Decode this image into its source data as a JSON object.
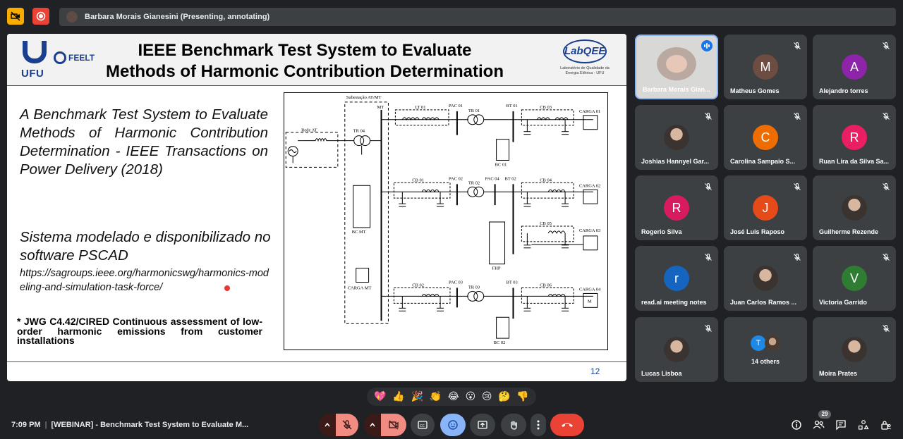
{
  "presenting": {
    "label": "Barbara Morais Gianesini (Presenting, annotating)"
  },
  "slide": {
    "title_line1": "IEEE Benchmark Test System to Evaluate",
    "title_line2": "Methods of Harmonic Contribution Determination",
    "logo_ufu": "UFU",
    "logo_feelt": "FEELT",
    "logo_labqee": "LabQEE",
    "labqee_sub": "Laboratório de Qualidade da Energia Elétrica - UFU",
    "reference": "A Benchmark Test System to Evaluate Methods of Harmonic Contribution Determination - IEEE Transactions on Power Delivery (2018)",
    "pscad": "Sistema modelado e disponibilizado no software PSCAD",
    "url": "https://sagroups.ieee.org/harmonicswg/harmonics-modeling-and-simulation-task-force/",
    "jwg": "* JWG C4.42/CIRED Continuous assessment of low-order harmonic emissions from customer installations",
    "page_number": "12",
    "diagram_labels": {
      "substation": "Subestação AT/MT",
      "mt": "MT",
      "rede_at": "Rede AT",
      "tr04": "TR 04",
      "lt01": "LT 01",
      "pac01": "PAC 01",
      "tr01": "TR 01",
      "bt01": "BT 01",
      "cb03": "CB 03",
      "carga01": "CARGA 01",
      "bc01": "BC 01",
      "bcmt": "BC MT",
      "cb01": "CB 01",
      "pac02": "PAC 02",
      "tr02": "TR 02",
      "pac04": "PAC 04",
      "bt02": "BT 02",
      "cb04": "CB 04",
      "carga02": "CARGA 02",
      "cb05": "CB 05",
      "carga03": "CARGA 03",
      "fhp": "FHP",
      "cargamt": "CARGA MT",
      "cb02": "CB 02",
      "pac03": "PAC 03",
      "tr03": "TR 03",
      "bt03": "BT 03",
      "cb06": "CB 06",
      "carga04": "CARGA 04",
      "bc02": "BC 02",
      "m": "M"
    }
  },
  "participants": [
    {
      "name": "Barbara Morais Gian...",
      "type": "video",
      "speaking": true
    },
    {
      "name": "Matheus Gomes",
      "initial": "M",
      "color": "#6d4c41"
    },
    {
      "name": "Alejandro torres",
      "initial": "A",
      "color": "#8e24aa"
    },
    {
      "name": "Joshias Hannyel Gar...",
      "type": "photo"
    },
    {
      "name": "Carolina Sampaio S...",
      "initial": "C",
      "color": "#ef6c00"
    },
    {
      "name": "Ruan Lira da Silva Sa...",
      "initial": "R",
      "color": "#e91e63"
    },
    {
      "name": "Rogerio Silva",
      "initial": "R",
      "color": "#d81b60"
    },
    {
      "name": "José Luis Raposo",
      "initial": "J",
      "color": "#e64a19"
    },
    {
      "name": "Guilherme Rezende",
      "type": "photo"
    },
    {
      "name": "read.ai meeting notes",
      "initial": "r",
      "color": "#1565c0"
    },
    {
      "name": "Juan Carlos Ramos ...",
      "type": "photo"
    },
    {
      "name": "Victoria Garrido",
      "initial": "V",
      "color": "#2e7d32"
    },
    {
      "name": "Lucas Lisboa",
      "type": "photo"
    },
    {
      "name": "14 others",
      "type": "others",
      "initial": "T"
    },
    {
      "name": "Moira Prates",
      "type": "photo"
    }
  ],
  "reactions": [
    "💖",
    "👍",
    "🎉",
    "👏",
    "😂",
    "😮",
    "😢",
    "🤔",
    "👎"
  ],
  "bottom": {
    "time": "7:09 PM",
    "meeting_title": "[WEBINAR] - Benchmark Test System to Evaluate M...",
    "people_count": "29"
  }
}
